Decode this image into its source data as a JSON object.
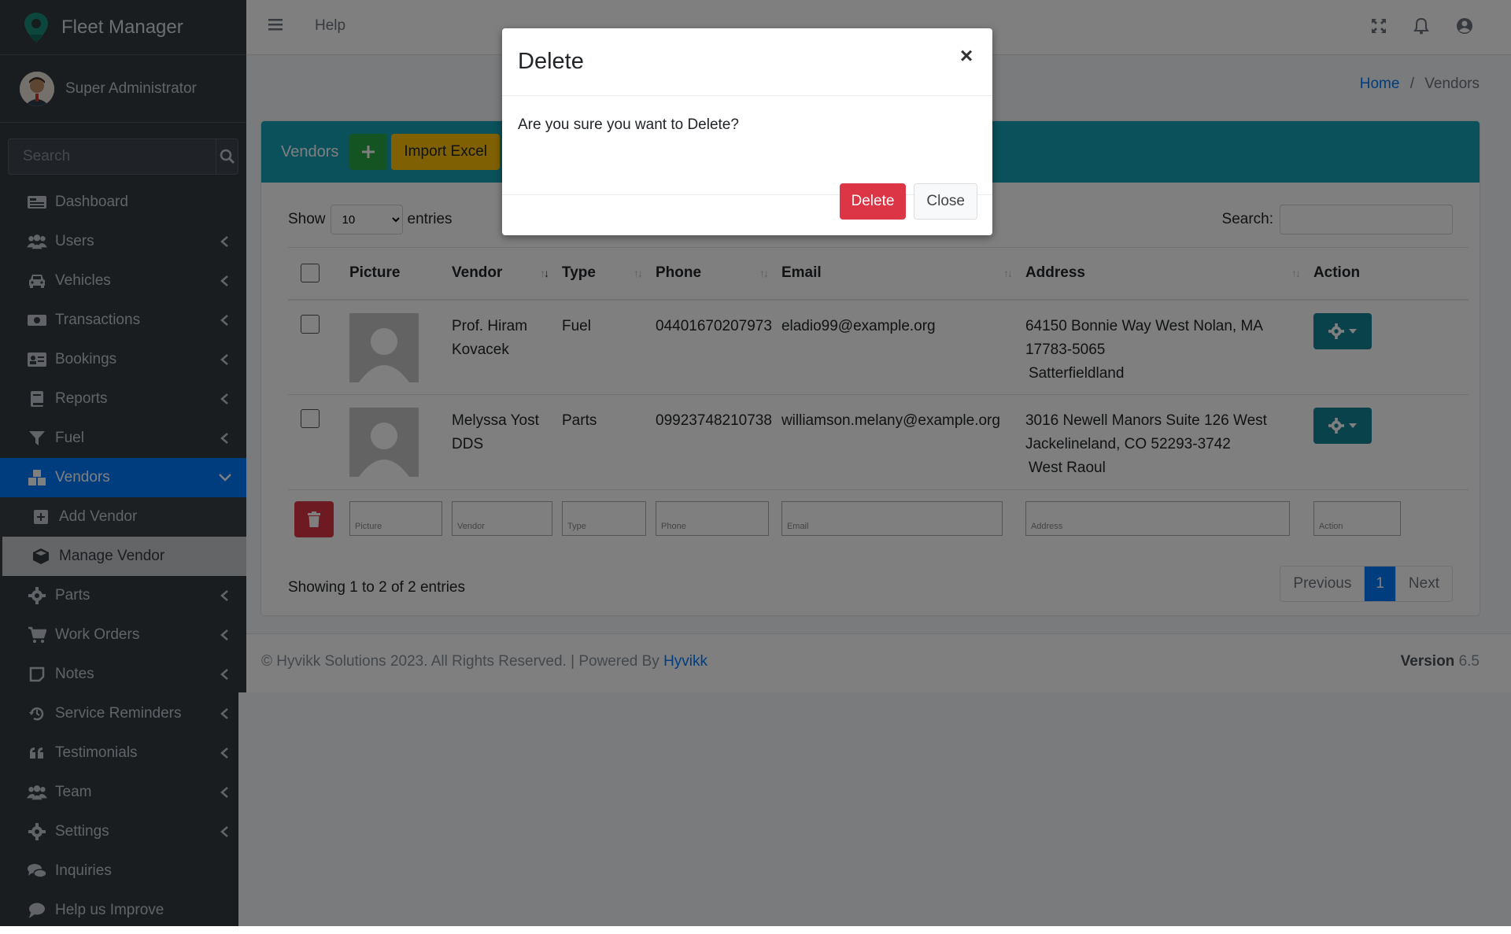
{
  "brand": {
    "name": "Fleet Manager"
  },
  "user": {
    "name": "Super Administrator"
  },
  "sidebar": {
    "search_placeholder": "Search",
    "items": [
      {
        "label": "Dashboard"
      },
      {
        "label": "Users"
      },
      {
        "label": "Vehicles"
      },
      {
        "label": "Transactions"
      },
      {
        "label": "Bookings"
      },
      {
        "label": "Reports"
      },
      {
        "label": "Fuel"
      },
      {
        "label": "Vendors"
      },
      {
        "label": "Add Vendor"
      },
      {
        "label": "Manage Vendor"
      },
      {
        "label": "Parts"
      },
      {
        "label": "Work Orders"
      },
      {
        "label": "Notes"
      },
      {
        "label": "Service Reminders"
      },
      {
        "label": "Testimonials"
      },
      {
        "label": "Team"
      },
      {
        "label": "Settings"
      },
      {
        "label": "Inquiries"
      },
      {
        "label": "Help us Improve"
      }
    ]
  },
  "topbar": {
    "help": "Help"
  },
  "breadcrumb": {
    "home": "Home",
    "sep": "/",
    "current": "Vendors"
  },
  "card": {
    "title": "Vendors",
    "import_label": "Import Excel"
  },
  "table_controls": {
    "show": "Show",
    "entries_value": "10",
    "entries": "entries",
    "search_label": "Search:"
  },
  "table": {
    "headers": [
      "Picture",
      "Vendor",
      "Type",
      "Phone",
      "Email",
      "Address",
      "Action"
    ],
    "rows": [
      {
        "vendor": "Prof. Hiram Kovacek",
        "type": "Fuel",
        "phone": "04401670207973",
        "email": "eladio99@example.org",
        "address": "64150 Bonnie Way West Nolan, MA 17783-5065",
        "city": "Satterfieldland"
      },
      {
        "vendor": "Melyssa Yost DDS",
        "type": "Parts",
        "phone": "09923748210738",
        "email": "williamson.melany@example.org",
        "address": "3016 Newell Manors Suite 126 West Jackelineland, CO 52293-3742",
        "city": "West Raoul"
      }
    ],
    "filters": [
      "Picture",
      "Vendor",
      "Type",
      "Phone",
      "Email",
      "Address",
      "Action"
    ]
  },
  "pagination": {
    "info": "Showing 1 to 2 of 2 entries",
    "prev": "Previous",
    "page": "1",
    "next": "Next"
  },
  "footer": {
    "copyright": "© Hyvikk Solutions 2023. All Rights Reserved. | Powered By ",
    "link": "Hyvikk",
    "version_label": "Version",
    "version": "6.5"
  },
  "modal": {
    "title": "Delete",
    "close_symbol": "×",
    "message": "Are you sure you want to Delete?",
    "delete_label": "Delete",
    "close_label": "Close"
  }
}
